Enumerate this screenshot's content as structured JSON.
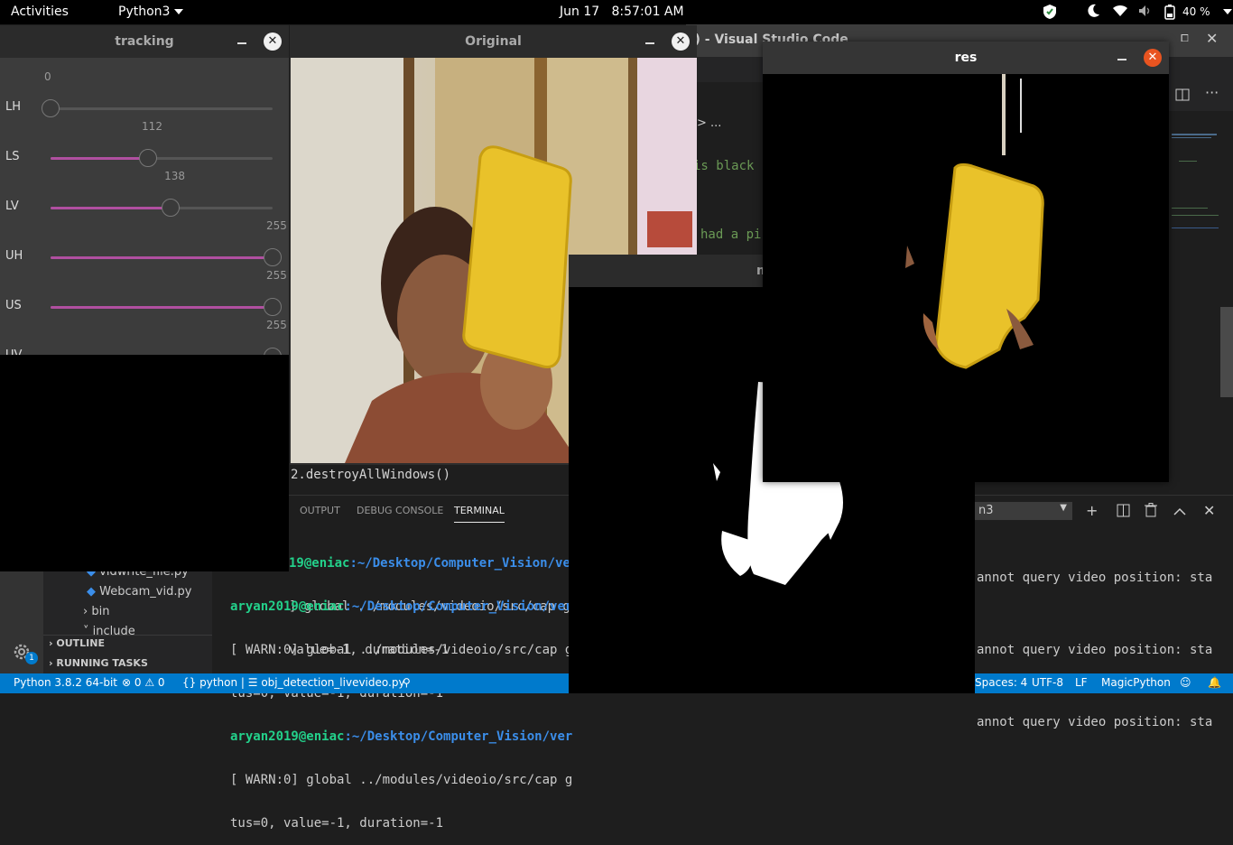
{
  "topbar": {
    "activities": "Activities",
    "app_menu": "Python3",
    "date": "Jun 17",
    "time": "8:57:01 AM",
    "battery": "40 %"
  },
  "vscode": {
    "title_fragment": "e) - Visual Studio Code",
    "breadcrumb": "> ...",
    "code_lines": [
      "is black",
      "had a pi",
      "2.destroyAllWindows()"
    ],
    "panel_tabs": [
      "OUTPUT",
      "DEBUG CONSOLE",
      "TERMINAL"
    ],
    "shell_select": "n3",
    "terminal": {
      "l1_user": "19@eniac",
      "l1_path": ":~/Desktop/Computer_Vision/ver",
      "l2": "] global ../modules/videoio/src/cap g",
      "l3": "value=-1, duration=-1",
      "l4_user": "aryan2019@eniac",
      "l4_path": ":~/Desktop/Computer_Vision/ver",
      "l5": "[ WARN:0] global ../modules/videoio/src/cap g",
      "l6": "tus=0, value=-1, duration=-1",
      "l7_user": "aryan2019@eniac",
      "l7_path": ":~/Desktop/Computer_Vision/ver",
      "l8": "[ WARN:0] global ../modules/videoio/src/cap g",
      "l9": "tus=0, value=-1, duration=-1",
      "r1": "annot query video position: sta",
      "r2": "annot query video position: sta",
      "r3": "annot query video position: sta"
    },
    "sidebar": {
      "files": [
        "vidwrite_file.py",
        "Webcam_vid.py"
      ],
      "folders": [
        "bin",
        "include"
      ],
      "outline": "OUTLINE",
      "running_tasks": "RUNNING TASKS",
      "gear_badge": "1"
    },
    "statusbar": {
      "python": "Python 3.8.2 64-bit",
      "errors": "0",
      "warnings": "0",
      "breadcrumb_py": "python",
      "file": "obj_detection_livevideo.py",
      "spaces": "Spaces: 4",
      "encoding": "UTF-8",
      "eol": "LF",
      "language": "MagicPython"
    }
  },
  "tracking": {
    "title": "tracking",
    "bars": [
      {
        "label": "LH",
        "value": 0,
        "max": 255
      },
      {
        "label": "LS",
        "value": 112,
        "max": 255
      },
      {
        "label": "LV",
        "value": 138,
        "max": 255
      },
      {
        "label": "UH",
        "value": 255,
        "max": 255
      },
      {
        "label": "US",
        "value": 255,
        "max": 255
      },
      {
        "label": "UV",
        "value": 255,
        "max": 255
      }
    ]
  },
  "original": {
    "title": "Original"
  },
  "mask": {
    "title": "m"
  },
  "res": {
    "title": "res"
  },
  "colors": {
    "accent": "#007acc",
    "ubuntu_orange": "#e95420",
    "trackbar_fill": "#b04fa0",
    "yellow_box": "#e9c22a"
  }
}
